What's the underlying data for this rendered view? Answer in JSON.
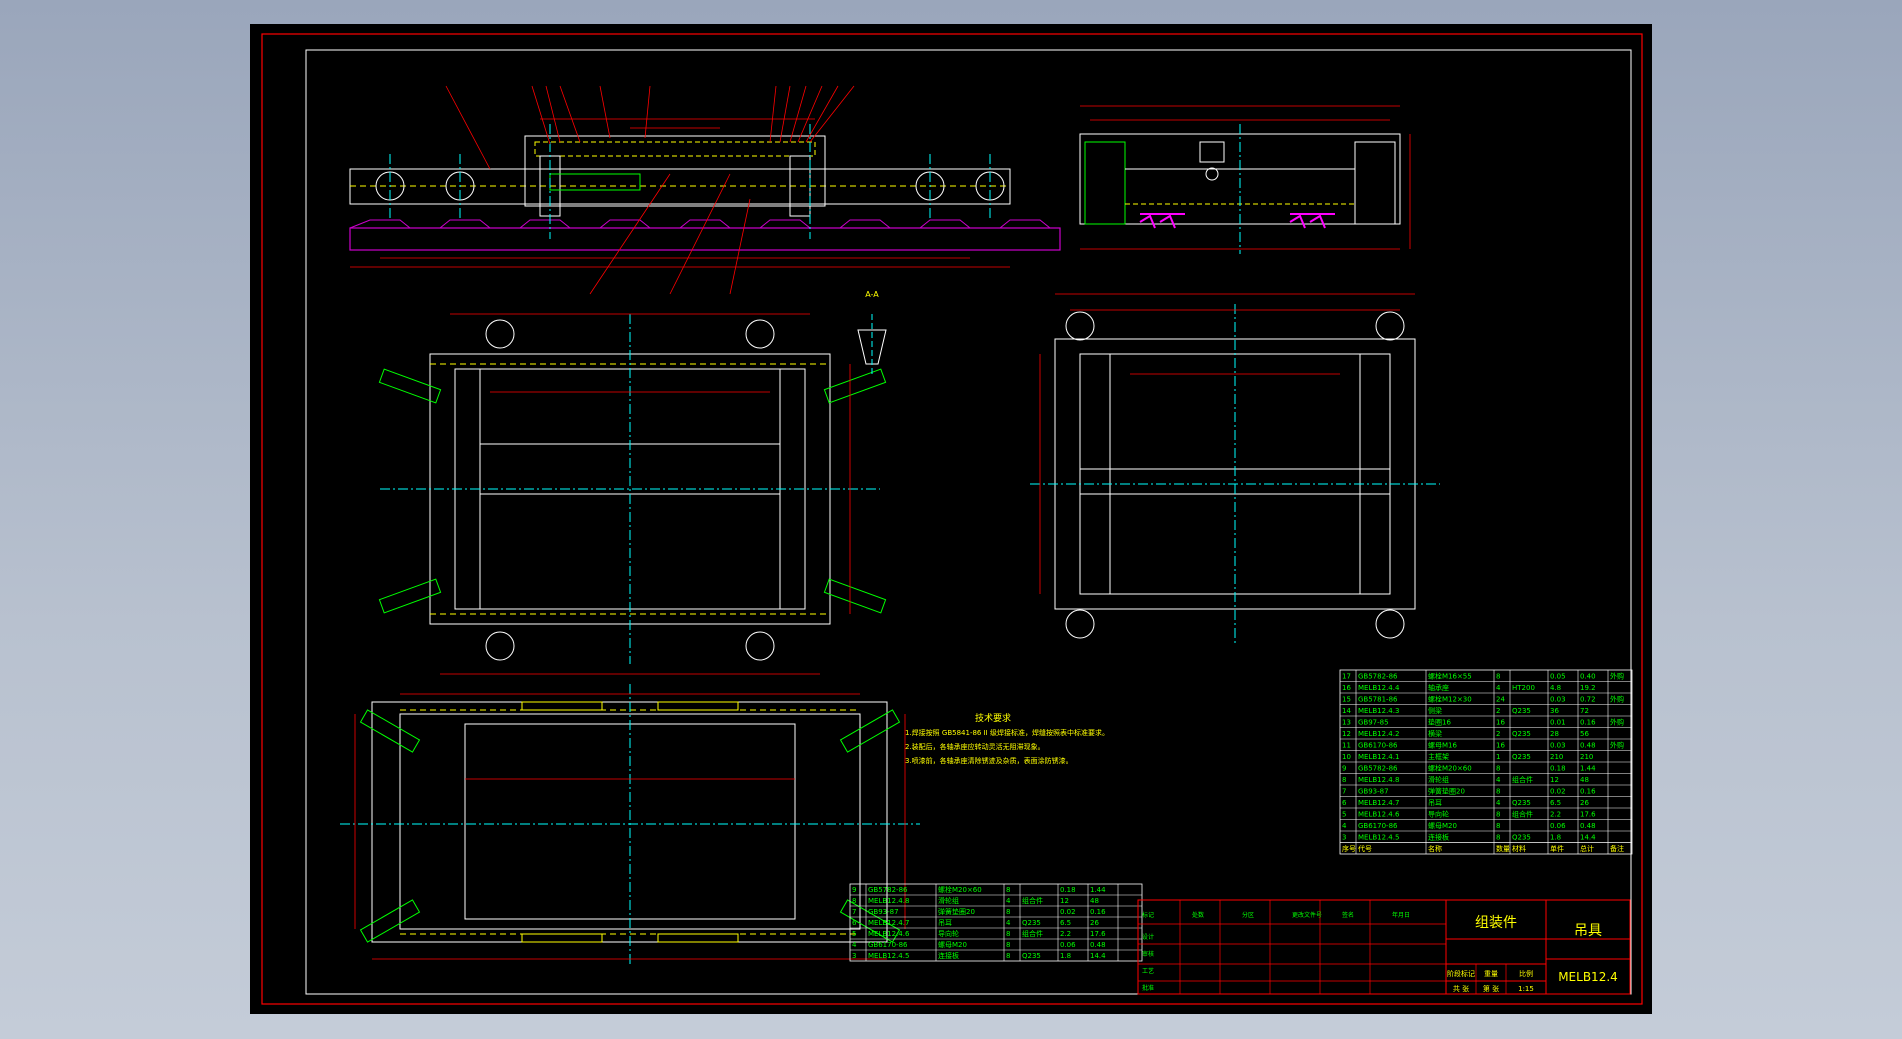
{
  "drawing": {
    "notes": {
      "title": "技术要求",
      "lines": [
        "1.焊接按照 GB5841-86 II 级焊接标准，焊缝按照表中标准要求。",
        "2.装配后，各轴承座应转动灵活无阻滞现象。",
        "3.喷漆前，各轴承座清除锈迹及杂质，表面涂防锈漆。"
      ]
    },
    "parts": [
      {
        "no": "17",
        "code": "GB5782-86",
        "name": "螺栓M16×55",
        "qty": "8",
        "material": "",
        "unit": "0.05",
        "total": "0.40",
        "note": "外购"
      },
      {
        "no": "16",
        "code": "MELB12.4.4",
        "name": "轴承座",
        "qty": "4",
        "material": "HT200",
        "unit": "4.8",
        "total": "19.2",
        "note": ""
      },
      {
        "no": "15",
        "code": "GB5781-86",
        "name": "螺栓M12×30",
        "qty": "24",
        "material": "",
        "unit": "0.03",
        "total": "0.72",
        "note": "外购"
      },
      {
        "no": "14",
        "code": "MELB12.4.3",
        "name": "侧梁",
        "qty": "2",
        "material": "Q235",
        "unit": "36",
        "total": "72",
        "note": ""
      },
      {
        "no": "13",
        "code": "GB97-85",
        "name": "垫圈16",
        "qty": "16",
        "material": "",
        "unit": "0.01",
        "total": "0.16",
        "note": "外购"
      },
      {
        "no": "12",
        "code": "MELB12.4.2",
        "name": "横梁",
        "qty": "2",
        "material": "Q235",
        "unit": "28",
        "total": "56",
        "note": ""
      },
      {
        "no": "11",
        "code": "GB6170-86",
        "name": "螺母M16",
        "qty": "16",
        "material": "",
        "unit": "0.03",
        "total": "0.48",
        "note": "外购"
      },
      {
        "no": "10",
        "code": "MELB12.4.1",
        "name": "主框架",
        "qty": "1",
        "material": "Q235",
        "unit": "210",
        "total": "210",
        "note": ""
      }
    ],
    "bom_headers": [
      "序号",
      "代号",
      "名称",
      "数量",
      "材料",
      "单件",
      "总计",
      "备注"
    ],
    "parts_lower": [
      {
        "no": "9",
        "code": "GB5782-86",
        "name": "螺栓M20×60",
        "qty": "8",
        "material": "",
        "unit": "0.18",
        "total": "1.44",
        "note": ""
      },
      {
        "no": "8",
        "code": "MELB12.4.8",
        "name": "滑轮组",
        "qty": "4",
        "material": "组合件",
        "unit": "12",
        "total": "48",
        "note": ""
      },
      {
        "no": "7",
        "code": "GB93-87",
        "name": "弹簧垫圈20",
        "qty": "8",
        "material": "",
        "unit": "0.02",
        "total": "0.16",
        "note": ""
      },
      {
        "no": "6",
        "code": "MELB12.4.7",
        "name": "吊耳",
        "qty": "4",
        "material": "Q235",
        "unit": "6.5",
        "total": "26",
        "note": ""
      },
      {
        "no": "5",
        "code": "MELB12.4.6",
        "name": "导向轮",
        "qty": "8",
        "material": "组合件",
        "unit": "2.2",
        "total": "17.6",
        "note": ""
      },
      {
        "no": "4",
        "code": "GB6170-86",
        "name": "螺母M20",
        "qty": "8",
        "material": "",
        "unit": "0.06",
        "total": "0.48",
        "note": ""
      },
      {
        "no": "3",
        "code": "MELB12.4.5",
        "name": "连接板",
        "qty": "8",
        "material": "Q235",
        "unit": "1.8",
        "total": "14.4",
        "note": ""
      }
    ],
    "title_block": {
      "name": "吊具",
      "drawing_no": "MELB12.4",
      "assembly": "组装件",
      "labels": [
        "阶段标记",
        "重量",
        "比例",
        "共 张",
        "第 张"
      ],
      "scale": "1:15",
      "signatures": [
        "标记",
        "处数",
        "分区",
        "更改文件号",
        "签名",
        "年月日",
        "设计",
        "审核",
        "工艺",
        "批准"
      ]
    },
    "section_label": "A-A"
  },
  "colors": {
    "line": "#ffffff",
    "yellow": "#ffff00",
    "red": "#ff0000",
    "green": "#00ff00",
    "cyan": "#00ffff",
    "magenta": "#ff00ff",
    "purple": "#cc00cc"
  }
}
